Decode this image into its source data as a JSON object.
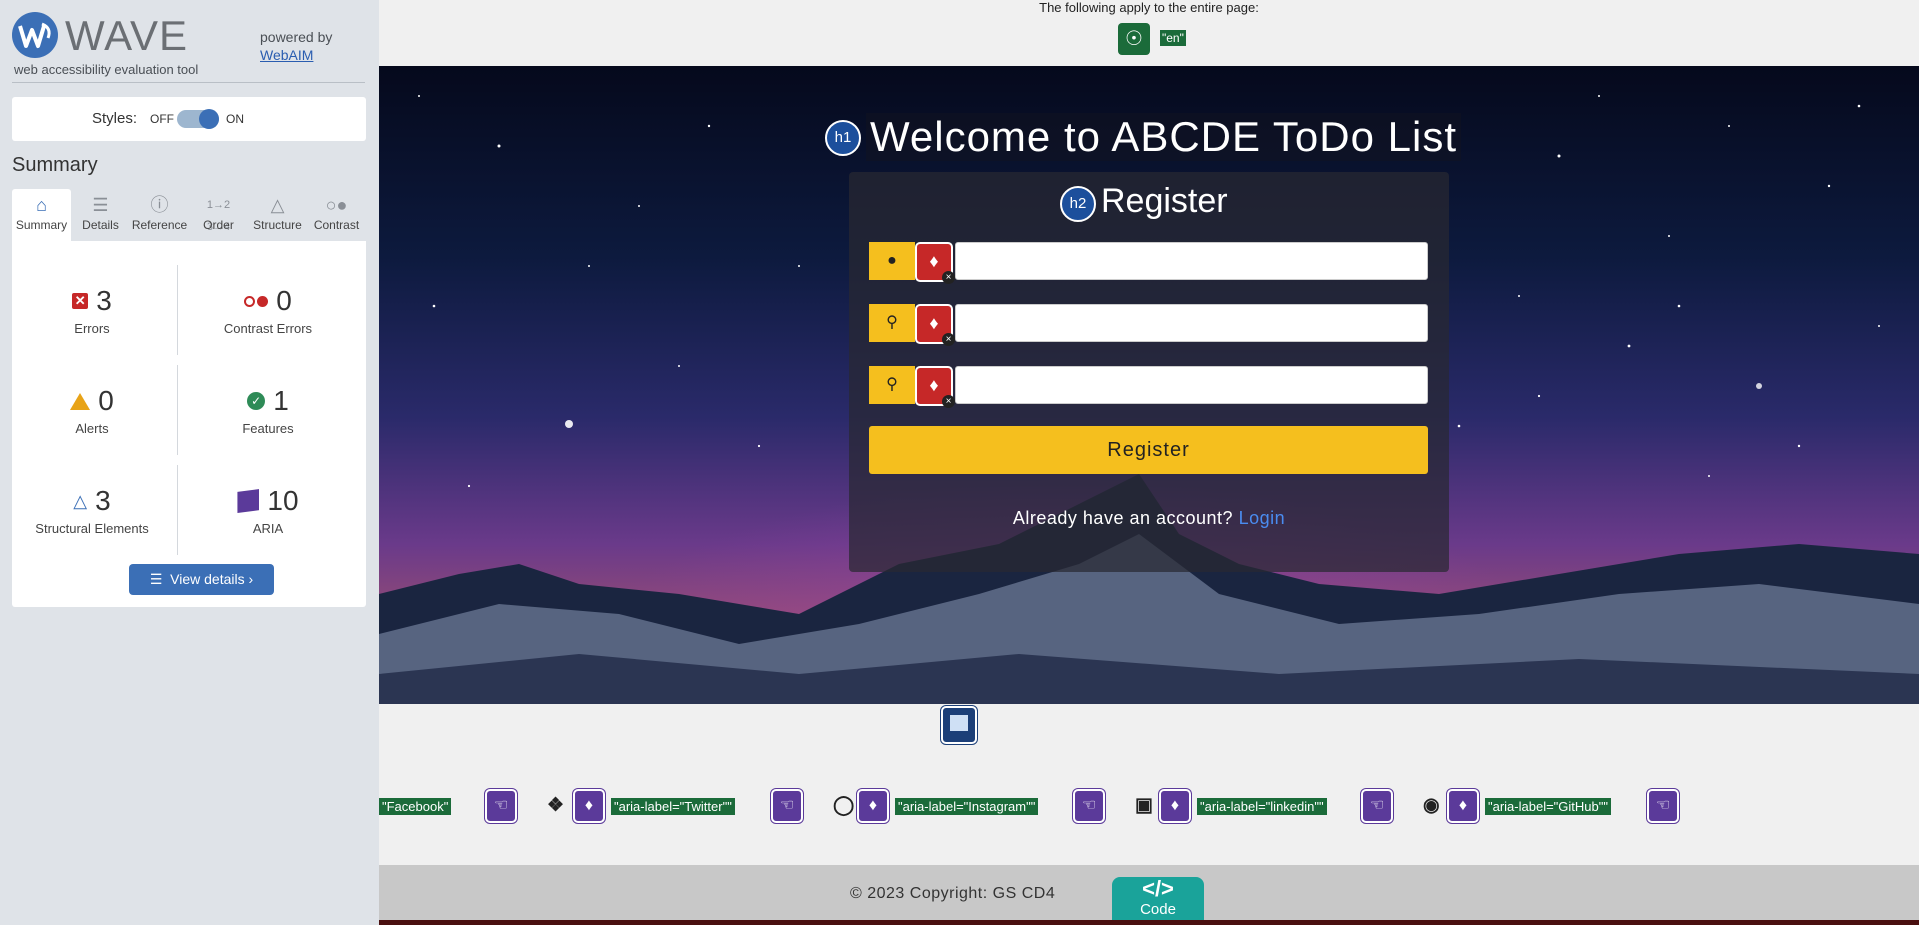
{
  "wave": {
    "title": "WAVE",
    "subtitle": "web accessibility evaluation tool",
    "powered_by": "powered by",
    "webaim_link": "WebAIM",
    "styles_label": "Styles:",
    "styles_off": "OFF",
    "styles_on": "ON",
    "summary_heading": "Summary",
    "tabs": [
      {
        "label": "Summary",
        "icon": "home-icon"
      },
      {
        "label": "Details",
        "icon": "list-icon"
      },
      {
        "label": "Reference",
        "icon": "info-icon"
      },
      {
        "label": "Order",
        "icon": "order-icon"
      },
      {
        "label": "Structure",
        "icon": "hierarchy-icon"
      },
      {
        "label": "Contrast",
        "icon": "contrast-icon"
      }
    ],
    "stats": {
      "errors": {
        "value": "3",
        "label": "Errors"
      },
      "contrast_errors": {
        "value": "0",
        "label": "Contrast Errors"
      },
      "alerts": {
        "value": "0",
        "label": "Alerts"
      },
      "features": {
        "value": "1",
        "label": "Features"
      },
      "structural": {
        "value": "3",
        "label": "Structural Elements"
      },
      "aria": {
        "value": "10",
        "label": "ARIA"
      }
    },
    "view_details": "View details ›",
    "colors": {
      "accent": "#3b6fb6",
      "error": "#c62828",
      "alert": "#e8a317",
      "feature": "#2e8b57",
      "aria": "#5b3a9a"
    }
  },
  "page": {
    "apply_note": "The following apply to the entire page:",
    "lang_tag": "\"en\"",
    "h1_badge": "h1",
    "title": "Welcome to ABCDE ToDo List",
    "h2_badge": "h2",
    "register_heading": "Register",
    "fields": [
      {
        "icon": "user-icon",
        "value": ""
      },
      {
        "icon": "key-icon",
        "value": ""
      },
      {
        "icon": "key-icon",
        "value": ""
      }
    ],
    "register_button": "Register",
    "account_text": "Already have an account?",
    "login_link": "Login",
    "social_tags": {
      "facebook": "\"Facebook\"",
      "twitter": "\"aria-label=\"Twitter\"\"",
      "instagram": "\"aria-label=\"Instagram\"\"",
      "linkedin": "\"aria-label=\"linkedin\"\"",
      "github": "\"aria-label=\"GitHub\"\""
    },
    "footer_text": "© 2023 Copyright: GS CD4",
    "code_badge_symbol": "</>",
    "code_badge_label": "Code",
    "colors": {
      "yellow": "#f5bf1e",
      "green_tag": "#1b6b3a",
      "purple": "#5b3a9a",
      "teal": "#1aa39a"
    }
  }
}
